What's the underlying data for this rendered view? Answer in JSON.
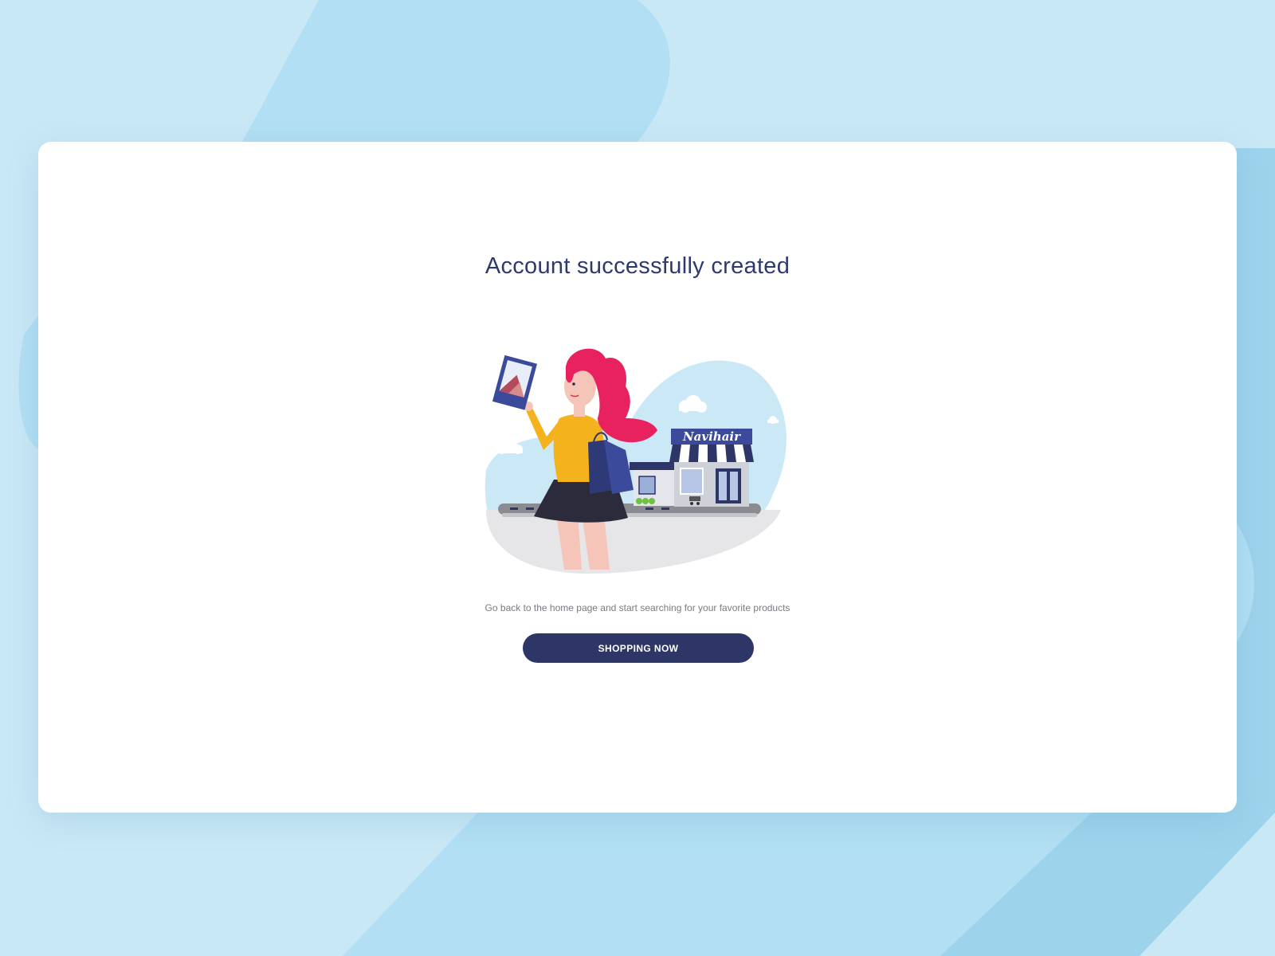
{
  "title": "Account successfully created",
  "subtitle": "Go back to the home page and start searching for your favorite products",
  "cta": {
    "label": "SHOPPING NOW"
  },
  "illustration": {
    "store_sign": "Navihair"
  },
  "colors": {
    "background": "#c9e8f6",
    "background_shape": "#b2dff3",
    "background_shape_dark": "#9ed3ec",
    "card": "#ffffff",
    "title": "#2e3a6e",
    "subtitle": "#7a7a82",
    "button": "#2e3668",
    "button_text": "#ffffff"
  },
  "icons": {
    "illustration": "shopping-girl-illustration"
  }
}
